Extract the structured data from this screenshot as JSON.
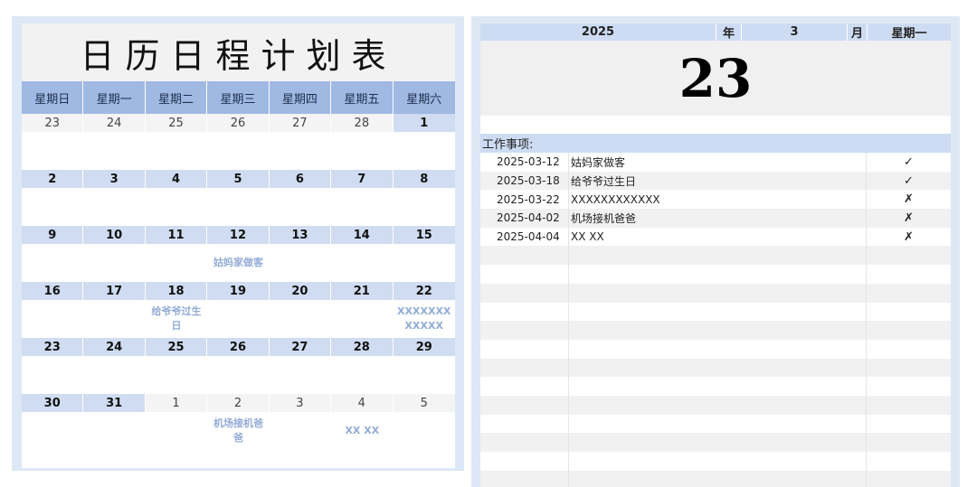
{
  "calendar": {
    "title": "日历日程计划表",
    "weekdays": [
      "星期日",
      "星期一",
      "星期二",
      "星期三",
      "星期四",
      "星期五",
      "星期六"
    ],
    "weeks": [
      [
        "23",
        "24",
        "25",
        "26",
        "27",
        "28",
        "1"
      ],
      [
        "2",
        "3",
        "4",
        "5",
        "6",
        "7",
        "8"
      ],
      [
        "9",
        "10",
        "11",
        "12",
        "13",
        "14",
        "15"
      ],
      [
        "16",
        "17",
        "18",
        "19",
        "20",
        "21",
        "22"
      ],
      [
        "23",
        "24",
        "25",
        "26",
        "27",
        "28",
        "29"
      ],
      [
        "30",
        "31",
        "1",
        "2",
        "3",
        "4",
        "5"
      ]
    ],
    "events": {
      "aunt_dinner": "姑妈家做客",
      "grandpa_birthday": "给爷爷过生日",
      "placeholder_event": "XXXXXXXXXXXX",
      "airport_pickup": "机场接机爸爸",
      "xx_event": "XX XX"
    }
  },
  "selected": {
    "year": "2025",
    "year_label": "年",
    "month": "3",
    "month_label": "月",
    "weekday": "星期一",
    "day": "23"
  },
  "todo": {
    "header": "工作事项:",
    "items": [
      {
        "date": "2025-03-12",
        "text": "姑妈家做客",
        "status": "✓"
      },
      {
        "date": "2025-03-18",
        "text": "给爷爷过生日",
        "status": "✓"
      },
      {
        "date": "2025-03-22",
        "text": "XXXXXXXXXXXX",
        "status": "✗"
      },
      {
        "date": "2025-04-02",
        "text": "机场接机爸爸",
        "status": "✗"
      },
      {
        "date": "2025-04-04",
        "text": "XX XX",
        "status": "✗"
      },
      {
        "date": "",
        "text": "",
        "status": ""
      },
      {
        "date": "",
        "text": "",
        "status": ""
      },
      {
        "date": "",
        "text": "",
        "status": ""
      },
      {
        "date": "",
        "text": "",
        "status": ""
      },
      {
        "date": "",
        "text": "",
        "status": ""
      },
      {
        "date": "",
        "text": "",
        "status": ""
      },
      {
        "date": "",
        "text": "",
        "status": ""
      },
      {
        "date": "",
        "text": "",
        "status": ""
      },
      {
        "date": "",
        "text": "",
        "status": ""
      },
      {
        "date": "",
        "text": "",
        "status": ""
      },
      {
        "date": "",
        "text": "",
        "status": ""
      },
      {
        "date": "",
        "text": "",
        "status": ""
      },
      {
        "date": "",
        "text": "",
        "status": ""
      },
      {
        "date": "",
        "text": "",
        "status": ""
      }
    ]
  }
}
